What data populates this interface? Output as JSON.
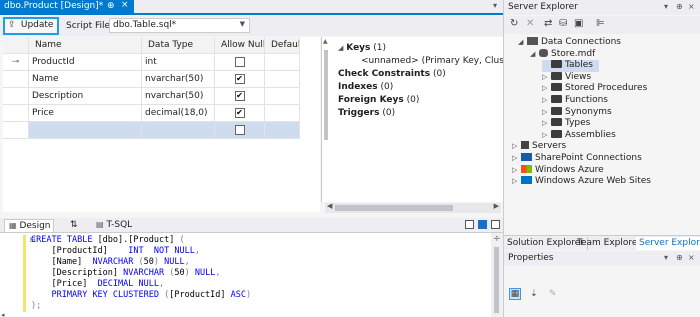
{
  "document_tab": {
    "title": "dbo.Product [Design]*",
    "pin_glyph": "⊕",
    "close_glyph": "×",
    "dropdown_glyph": "▾"
  },
  "toolbar": {
    "update_label": "Update",
    "script_file_label": "Script File:",
    "script_file_value": "dbo.Table.sql*"
  },
  "grid": {
    "headers": [
      "Name",
      "Data Type",
      "Allow Nulls",
      "Default"
    ],
    "rows": [
      {
        "key": "⊸",
        "name": "ProductId",
        "type": "int",
        "allow_nulls": false,
        "default": ""
      },
      {
        "key": "",
        "name": "Name",
        "type": "nvarchar(50)",
        "allow_nulls": true,
        "default": ""
      },
      {
        "key": "",
        "name": "Description",
        "type": "nvarchar(50)",
        "allow_nulls": true,
        "default": ""
      },
      {
        "key": "",
        "name": "Price",
        "type": "decimal(18,0)",
        "allow_nulls": true,
        "default": ""
      },
      {
        "key": "",
        "name": "",
        "type": "",
        "allow_nulls": false,
        "default": ""
      }
    ]
  },
  "designer_props": {
    "keys_label": "Keys",
    "keys_count": "(1)",
    "key_item": "<unnamed>   (Primary Key, Clustere",
    "check_constraints": "Check Constraints",
    "check_count": "(0)",
    "indexes": "Indexes",
    "indexes_count": "(0)",
    "foreign_keys": "Foreign Keys",
    "foreign_keys_count": "(0)",
    "triggers": "Triggers",
    "triggers_count": "(0)"
  },
  "pane_tabs": {
    "design": "Design",
    "swap": "⇅",
    "tsql": "T-SQL"
  },
  "sql": {
    "zoom": "◂",
    "lines": [
      "CREATE TABLE [dbo].[Product] (",
      "    [ProductId]    INT  NOT NULL,",
      "    [Name]  NVARCHAR (50) NULL,",
      "    [Description] NVARCHAR (50) NULL,",
      "    [Price]  DECIMAL NULL,",
      "    PRIMARY KEY CLUSTERED ([ProductId] ASC)",
      ");"
    ]
  },
  "server_explorer": {
    "title": "Server Explorer",
    "tree": [
      {
        "label": "Data Connections",
        "level": 1,
        "expander": "◢",
        "icon": "dc"
      },
      {
        "label": "Store.mdf",
        "level": 2,
        "expander": "◢",
        "icon": "db"
      },
      {
        "label": "Tables",
        "level": 3,
        "expander": "",
        "icon": "folder",
        "selected": true
      },
      {
        "label": "Views",
        "level": 3,
        "expander": "▷",
        "icon": "folder"
      },
      {
        "label": "Stored Procedures",
        "level": 3,
        "expander": "▷",
        "icon": "folder"
      },
      {
        "label": "Functions",
        "level": 3,
        "expander": "▷",
        "icon": "folder"
      },
      {
        "label": "Synonyms",
        "level": 3,
        "expander": "▷",
        "icon": "folder"
      },
      {
        "label": "Types",
        "level": 3,
        "expander": "▷",
        "icon": "folder"
      },
      {
        "label": "Assemblies",
        "level": 3,
        "expander": "▷",
        "icon": "folder"
      },
      {
        "label": "Servers",
        "level": 0,
        "expander": "▷",
        "icon": "srv"
      },
      {
        "label": "SharePoint Connections",
        "level": 0,
        "expander": "▷",
        "icon": "sp"
      },
      {
        "label": "Windows Azure",
        "level": 0,
        "expander": "▷",
        "icon": "win"
      },
      {
        "label": "Windows Azure Web Sites",
        "level": 0,
        "expander": "▷",
        "icon": "azure"
      }
    ],
    "tabs": [
      "Solution Explorer",
      "Team Explorer",
      "Server Explorer"
    ]
  },
  "properties": {
    "title": "Properties"
  },
  "colors": {
    "accent": "#007acc",
    "selection": "#cfdcef",
    "update_border": "#1ba1e2"
  }
}
